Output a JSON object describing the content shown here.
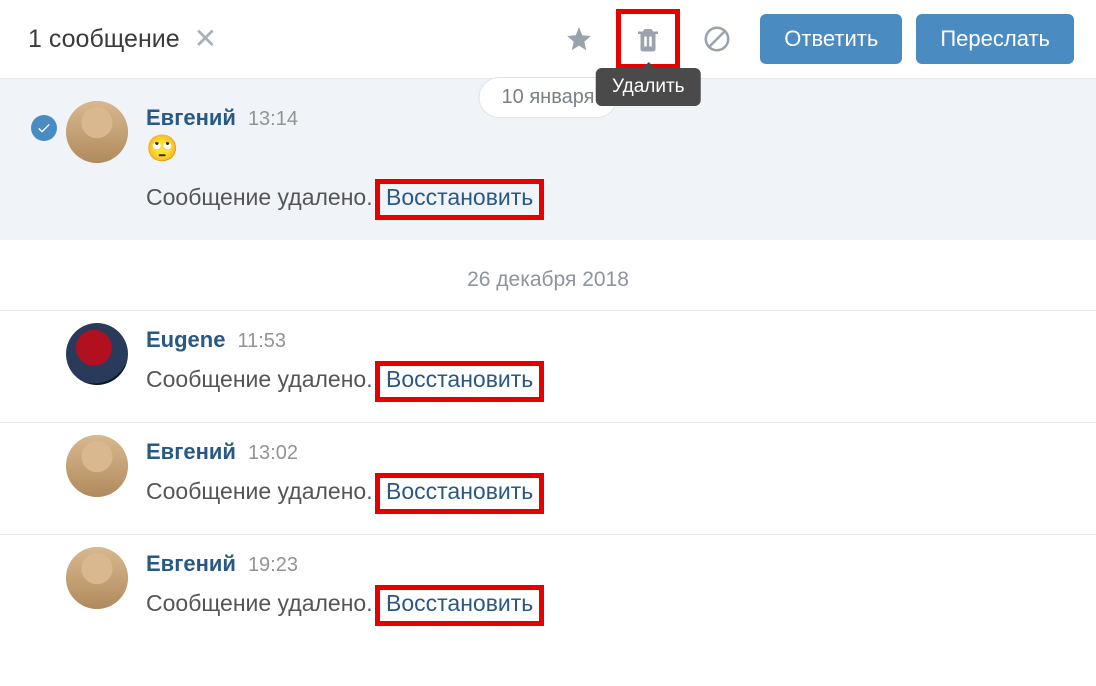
{
  "header": {
    "selection_label": "1 сообщение",
    "reply_label": "Ответить",
    "forward_label": "Переслать",
    "delete_tooltip": "Удалить"
  },
  "floating_date": "10 января",
  "divider_date": "26 декабря 2018",
  "messages": [
    {
      "name": "Евгений",
      "time": "13:14",
      "selected": true,
      "avatar": "av1",
      "emoji": "🙄",
      "deleted_text": "Сообщение удалено.",
      "restore_label": "Восстановить"
    },
    {
      "name": "Eugene",
      "time": "11:53",
      "avatar": "av2",
      "deleted_text": "Сообщение удалено.",
      "restore_label": "Восстановить"
    },
    {
      "name": "Евгений",
      "time": "13:02",
      "avatar": "av1",
      "deleted_text": "Сообщение удалено.",
      "restore_label": "Восстановить"
    },
    {
      "name": "Евгений",
      "time": "19:23",
      "avatar": "av1",
      "deleted_text": "Сообщение удалено.",
      "restore_label": "Восстановить"
    }
  ]
}
